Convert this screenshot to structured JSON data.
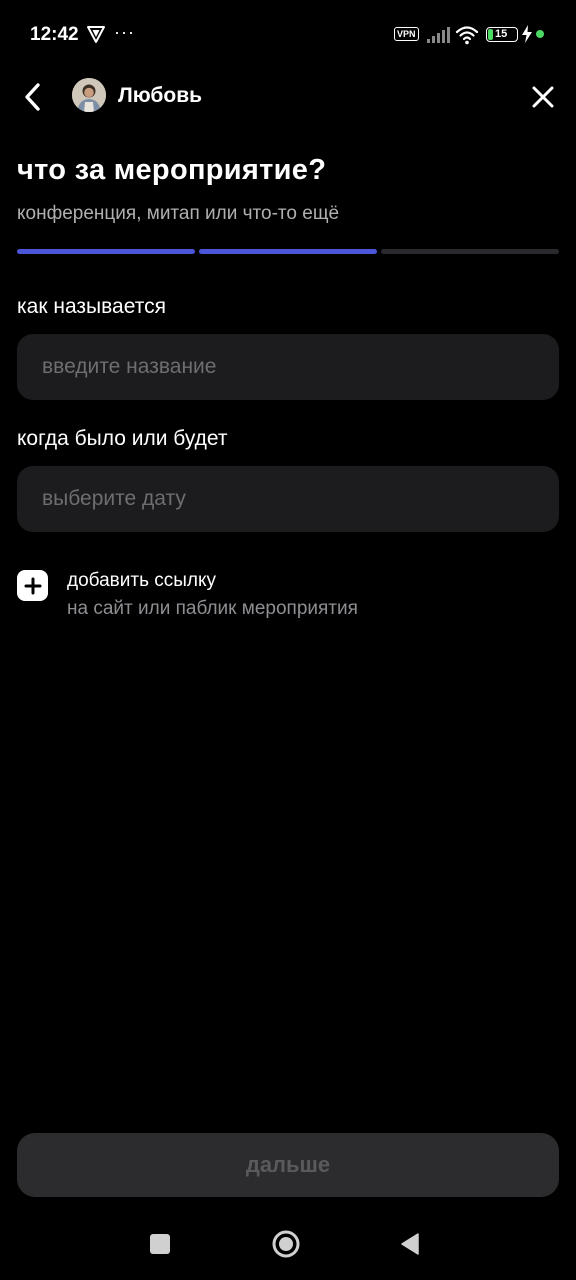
{
  "status_bar": {
    "time": "12:42",
    "dots": "···",
    "vpn": "VPN",
    "battery": "15",
    "battery_color": "#4cd964"
  },
  "header": {
    "name": "Любовь",
    "back_icon": "chevron-left-icon",
    "close_icon": "close-icon"
  },
  "page": {
    "title": "что за мероприятие?",
    "subtitle": "конференция, митап или что-то ещё",
    "progress_step": 2,
    "progress_total": 3,
    "accent_color": "#4a55d8"
  },
  "form": {
    "name_label": "как называется",
    "name_placeholder": "введите название",
    "name_value": "",
    "date_label": "когда было или будет",
    "date_placeholder": "выберите дату",
    "date_value": ""
  },
  "add_link": {
    "title": "добавить ссылку",
    "subtitle": "на сайт или паблик мероприятия",
    "icon": "plus-icon"
  },
  "next_button": {
    "label": "дальше"
  },
  "nav_bar": {
    "recent_icon": "square-icon",
    "home_icon": "circle-icon",
    "back_icon": "triangle-back-icon"
  }
}
